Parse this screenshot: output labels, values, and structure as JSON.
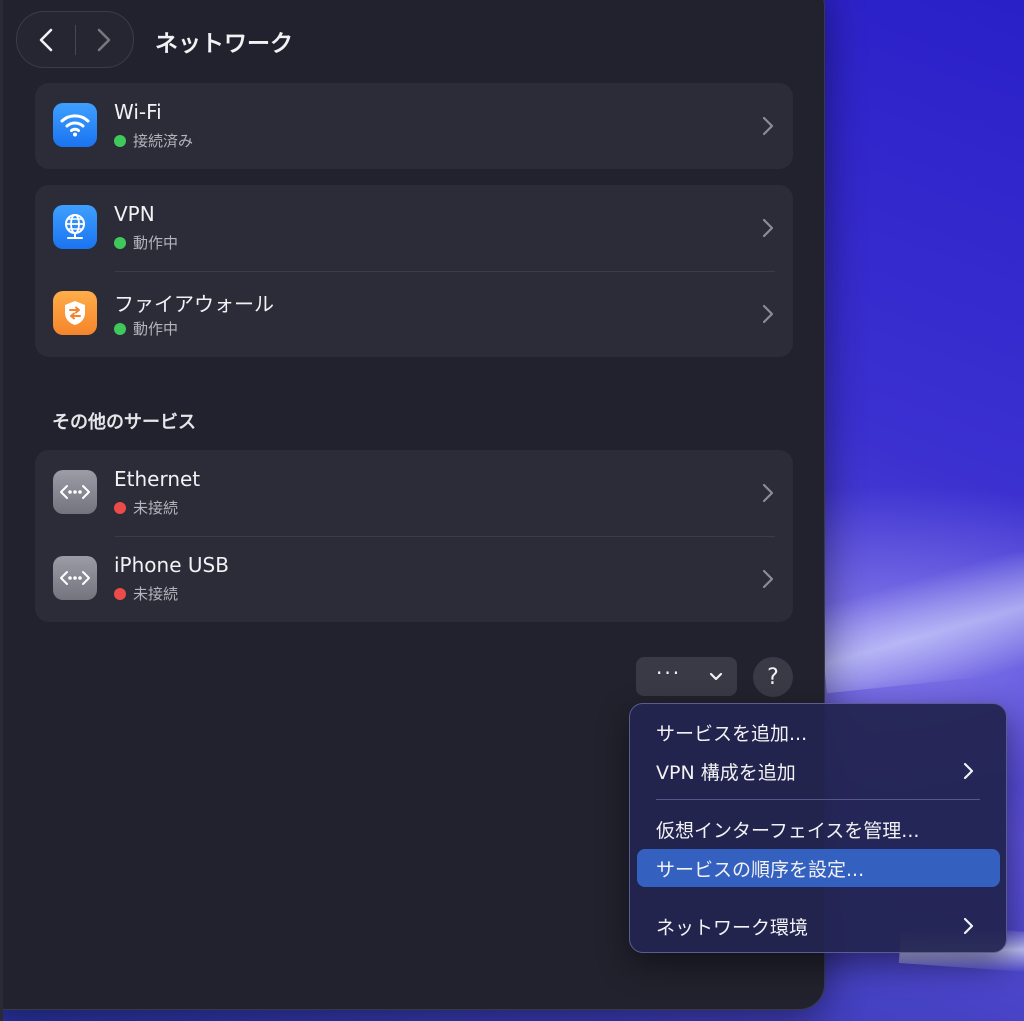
{
  "window": {
    "title": "ネットワーク",
    "nav": {
      "back_icon": "chevron-left-icon",
      "forward_icon": "chevron-right-icon"
    }
  },
  "services": [
    {
      "name": "Wi-Fi",
      "status": "接続済み",
      "status_color": "#3ec95a",
      "icon": "wifi-icon"
    },
    {
      "name": "VPN",
      "status": "動作中",
      "status_color": "#3ec95a",
      "icon": "globe-icon"
    },
    {
      "name": "ファイアウォール",
      "status": "動作中",
      "status_color": "#3ec95a",
      "icon": "firewall-icon"
    }
  ],
  "other_services": {
    "header": "その他のサービス",
    "items": [
      {
        "name": "Ethernet",
        "status": "未接続",
        "status_color": "#eb4b49",
        "icon": "ethernet-icon"
      },
      {
        "name": "iPhone USB",
        "status": "未接続",
        "status_color": "#eb4b49",
        "icon": "ethernet-icon"
      }
    ]
  },
  "toolbar": {
    "more_label": "···",
    "help_label": "?"
  },
  "menu": {
    "items": [
      {
        "label": "サービスを追加...",
        "submenu": false,
        "highlighted": false
      },
      {
        "label": "VPN 構成を追加",
        "submenu": true,
        "highlighted": false
      },
      {
        "label": "仮想インターフェイスを管理...",
        "submenu": false,
        "highlighted": false
      },
      {
        "label": "サービスの順序を設定...",
        "submenu": false,
        "highlighted": true
      },
      {
        "label": "ネットワーク環境",
        "submenu": true,
        "highlighted": false
      }
    ]
  },
  "colors": {
    "accent": "#3461c0",
    "window_bg": "#22222e",
    "group_bg": "#2c2c38",
    "connected": "#3ec95a",
    "disconnected": "#eb4b49"
  }
}
